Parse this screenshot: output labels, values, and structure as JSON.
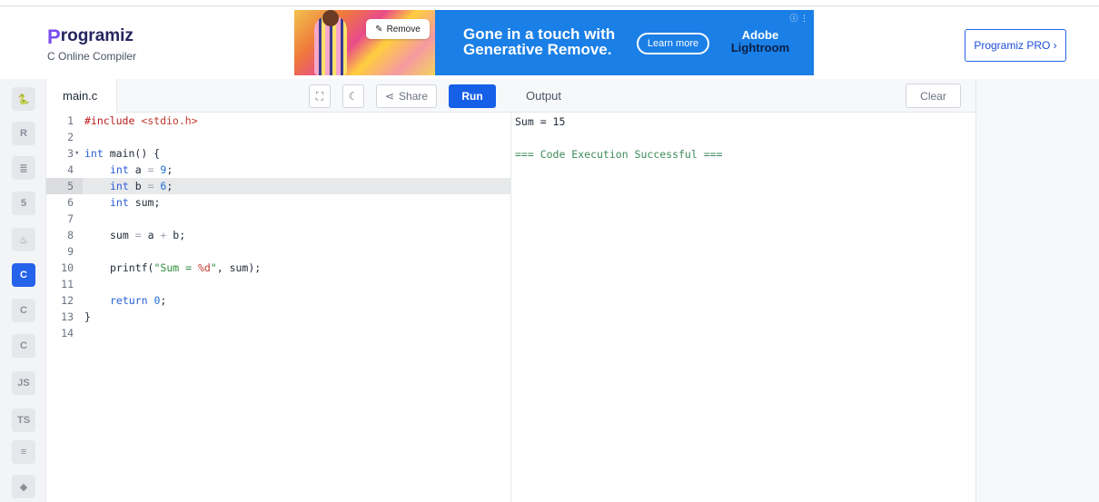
{
  "header": {
    "logo_initial": "P",
    "logo_rest": "rogramiz",
    "subtitle": "C Online Compiler",
    "pro_button": "Programiz PRO ›"
  },
  "ad": {
    "remove_label": "Remove",
    "headline_line1": "Gone in a touch with",
    "headline_line2": "Generative Remove.",
    "learn_more": "Learn more",
    "brand_line1": "Adobe",
    "brand_line2": "Lightroom",
    "info": "ⓘ ⋮"
  },
  "sidebar": {
    "items": [
      {
        "name": "python",
        "label": "🐍"
      },
      {
        "name": "r",
        "label": "R"
      },
      {
        "name": "sql",
        "label": "≣"
      },
      {
        "name": "html",
        "label": "5"
      },
      {
        "name": "java",
        "label": "♨"
      },
      {
        "name": "c",
        "label": "C",
        "active": true
      },
      {
        "name": "cpp",
        "label": "C"
      },
      {
        "name": "csharp",
        "label": "C"
      },
      {
        "name": "js",
        "label": "JS"
      },
      {
        "name": "ts",
        "label": "TS"
      },
      {
        "name": "go",
        "label": "≡"
      },
      {
        "name": "swift",
        "label": "◆"
      }
    ]
  },
  "editor": {
    "file_name": "main.c",
    "share_label": "Share",
    "run_label": "Run",
    "lines": [
      "1",
      "2",
      "3",
      "4",
      "5",
      "6",
      "7",
      "8",
      "9",
      "10",
      "11",
      "12",
      "13",
      "14"
    ],
    "code": {
      "l1_a": "#include ",
      "l1_b": "<stdio.h>",
      "l3_a": "int",
      "l3_b": " main() {",
      "l4_a": "int",
      "l4_b": " a ",
      "l4_c": "=",
      "l4_d": " 9",
      "l4_e": ";",
      "l5_a": "int",
      "l5_b": " b ",
      "l5_c": "=",
      "l5_d": " 6",
      "l5_e": ";",
      "l6_a": "int",
      "l6_b": " sum;",
      "l8_a": "sum ",
      "l8_b": "=",
      "l8_c": " a ",
      "l8_d": "+",
      "l8_e": " b;",
      "l10_a": "printf(",
      "l10_b": "\"Sum = ",
      "l10_c": "%d",
      "l10_d": "\"",
      "l10_e": ", sum);",
      "l12_a": "return",
      "l12_b": " 0",
      "l12_c": ";",
      "l13_a": "}"
    }
  },
  "output": {
    "title": "Output",
    "clear_label": "Clear",
    "line1": "Sum = 15",
    "line2": "",
    "line3": "=== Code Execution Successful ==="
  }
}
